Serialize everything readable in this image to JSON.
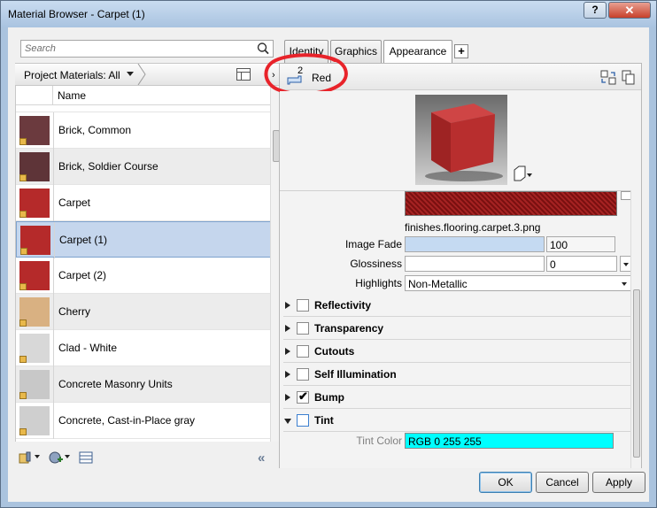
{
  "window": {
    "title": "Material Browser - Carpet (1)",
    "help_label": "?",
    "close_label": "✕"
  },
  "search": {
    "placeholder": "Search"
  },
  "library": {
    "filter_label": "Project Materials: All",
    "column_name": "Name"
  },
  "materials": [
    {
      "name": "Brick, Common",
      "swatch": "#6b3a3e"
    },
    {
      "name": "Brick, Soldier Course",
      "swatch": "#5e3438"
    },
    {
      "name": "Carpet",
      "swatch": "#b52a2a"
    },
    {
      "name": "Carpet (1)",
      "swatch": "#b52a2a",
      "selected": true
    },
    {
      "name": "Carpet (2)",
      "swatch": "#b52a2a"
    },
    {
      "name": "Cherry",
      "swatch": "#d9b182"
    },
    {
      "name": "Clad - White",
      "swatch": "#d8d8d8"
    },
    {
      "name": "Concrete Masonry Units",
      "swatch": "#c8c8c8"
    },
    {
      "name": "Concrete, Cast-in-Place gray",
      "swatch": "#cfcfcf"
    }
  ],
  "tabs": [
    {
      "label": "Identity",
      "active": false
    },
    {
      "label": "Graphics",
      "active": false
    },
    {
      "label": "Appearance",
      "active": true
    }
  ],
  "tab_add_label": "+",
  "asset": {
    "count": "2",
    "name": "Red"
  },
  "appearance": {
    "image_filename": "finishes.flooring.carpet.3.png",
    "image_fade": {
      "label": "Image Fade",
      "value": "100"
    },
    "glossiness": {
      "label": "Glossiness",
      "value": "0"
    },
    "highlights": {
      "label": "Highlights",
      "value": "Non-Metallic"
    }
  },
  "sections": [
    {
      "label": "Reflectivity",
      "checked": false,
      "open": false
    },
    {
      "label": "Transparency",
      "checked": false,
      "open": false
    },
    {
      "label": "Cutouts",
      "checked": false,
      "open": false
    },
    {
      "label": "Self Illumination",
      "checked": false,
      "open": false
    },
    {
      "label": "Bump",
      "checked": true,
      "open": false
    },
    {
      "label": "Tint",
      "checked": false,
      "open": true
    }
  ],
  "tint": {
    "label": "Tint Color",
    "value": "RGB 0 255 255",
    "color": "#00ffff"
  },
  "buttons": {
    "ok": "OK",
    "cancel": "Cancel",
    "apply": "Apply"
  },
  "colors": {
    "accent": "#c5d6ed",
    "annotation": "#e8232a"
  }
}
